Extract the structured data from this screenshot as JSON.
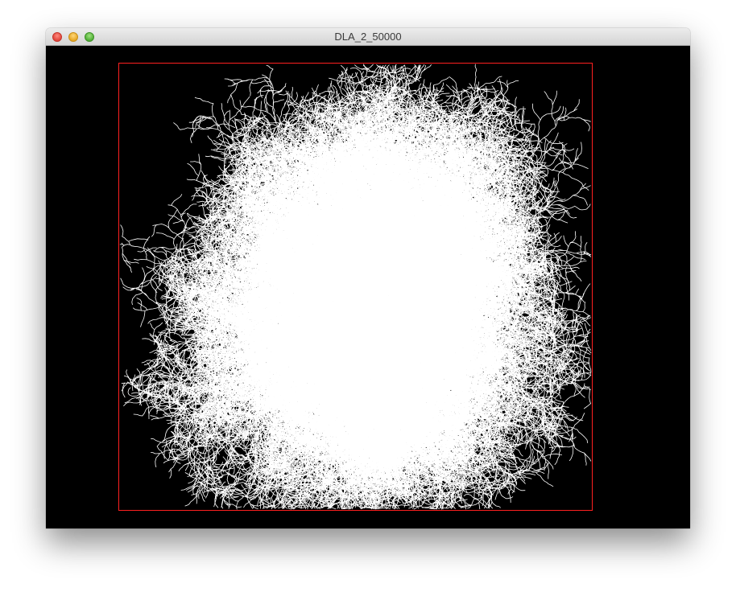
{
  "window": {
    "title": "DLA_2_50000",
    "controls": {
      "close": "close-icon",
      "minimize": "minimize-icon",
      "zoom": "zoom-icon"
    }
  },
  "simulation": {
    "particles": 50000,
    "background_color": "#000000",
    "particle_color": "#ffffff",
    "boundary_color": "#ff2020"
  }
}
